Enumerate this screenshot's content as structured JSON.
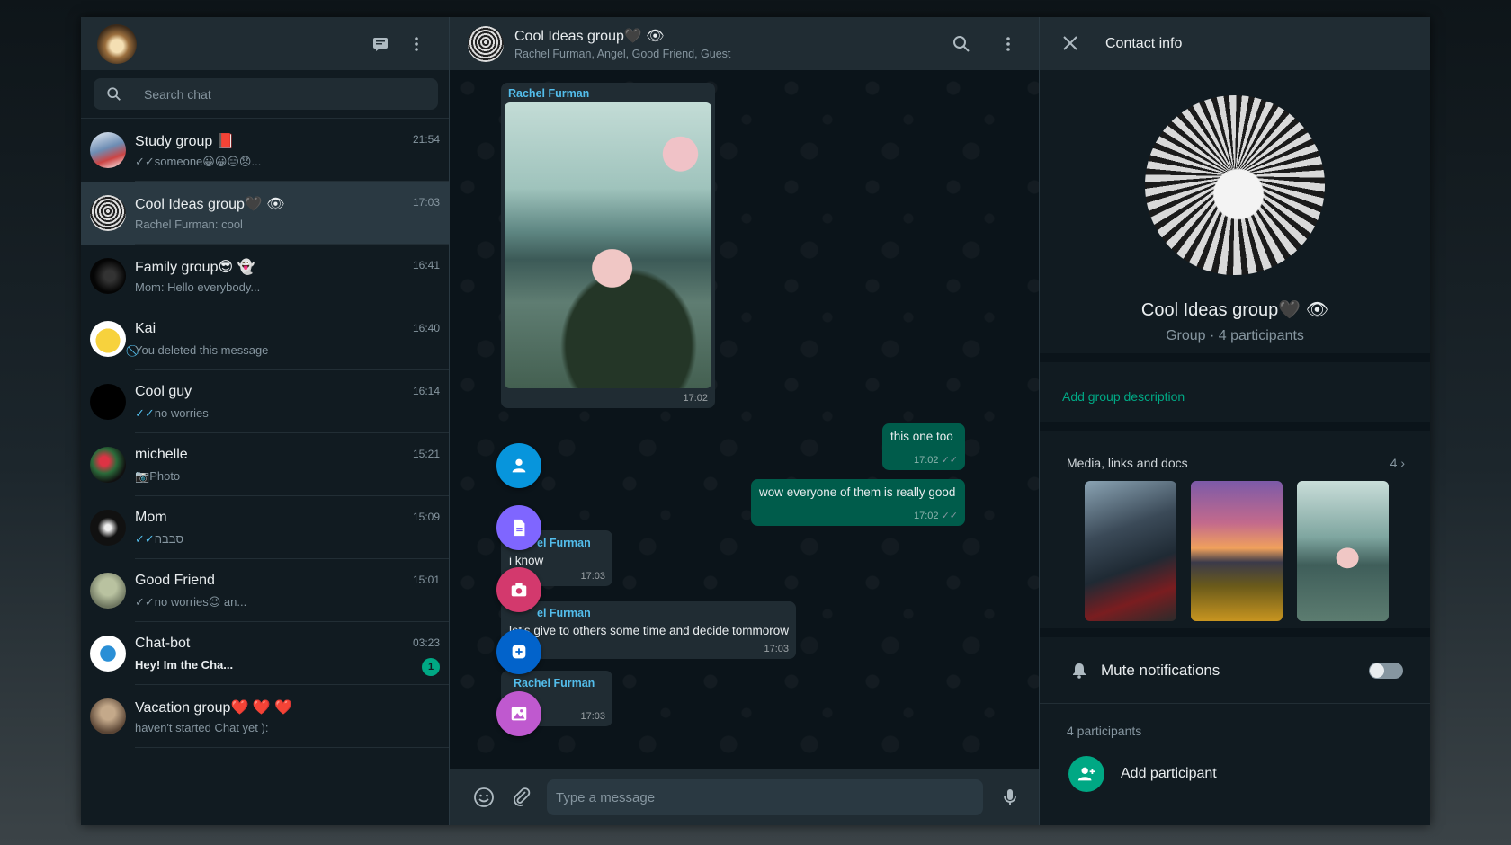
{
  "left": {
    "search_placeholder": "Search chat",
    "chats": [
      {
        "name": "Study group 📕",
        "time": "21:54",
        "tick": "✓✓",
        "preview": "someone😀😀😑😞...",
        "avatar": "linear-gradient(160deg,#e8eef5 0%,#6d8db4 45%,#c44 70%,#fff 100%)"
      },
      {
        "name": "Cool Ideas group🖤 👁",
        "time": "17:03",
        "tick": "",
        "preview": "Rachel Furman: cool",
        "avatar": "repeating-radial-gradient(circle at 50% 45%, #ddd 0 2px, #222 2px 4px)"
      },
      {
        "name": "Family group😎 👻",
        "time": "16:41",
        "tick": "",
        "preview": "Mom: Hello everybody...",
        "avatar": "radial-gradient(circle at 55% 50%, #333 0 20%, #050505 60%)"
      },
      {
        "name": "Kai",
        "time": "16:40",
        "tick": "⃠",
        "preview": "You deleted this message",
        "avatar": "radial-gradient(circle at 50% 55%, #f7d23d 0 45%, #fff 46%)"
      },
      {
        "name": "Cool guy",
        "time": "16:14",
        "tick": "✓✓",
        "preview": "no worries",
        "avatar": "#000"
      },
      {
        "name": "michelle",
        "time": "15:21",
        "tick": "📷",
        "preview": "Photo",
        "avatar": "radial-gradient(circle at 40% 40%, #d34 0 15%, #2b6b3a 40%, #111 70%)"
      },
      {
        "name": "Mom",
        "time": "15:09",
        "tick": "✓✓",
        "preview": "סבבה",
        "avatar": "radial-gradient(circle at 50% 50%, #eee 0 12%, #111 40%)"
      },
      {
        "name": "Good Friend",
        "time": "15:01",
        "tick": "✓✓",
        "preview": "no worries😉 an...",
        "avatar": "radial-gradient(circle at 50% 40%, #b9c2a0 0 30%, #6e7660 70%)"
      },
      {
        "name": "Chat-bot",
        "time": "03:23",
        "tick": "",
        "preview": "Hey! Im the Cha...",
        "bold": true,
        "unread": "1",
        "avatar": "radial-gradient(circle at 50% 50%, #2a8fd6 0 30%, #fff 32%)"
      },
      {
        "name": "Vacation group❤️ ❤️ ❤️",
        "time": "",
        "tick": "",
        "preview": "haven't started Chat yet ):",
        "avatar": "radial-gradient(circle at 50% 40%, #c4a98a 0 25%, #5a4535 70%)"
      }
    ]
  },
  "middle": {
    "title": "Cool Ideas group🖤 👁",
    "subtitle": "Rachel Furman, Angel, Good Friend, Guest",
    "compose_placeholder": "Type a message",
    "messages": {
      "photo_sender": "Rachel Furman",
      "photo_time": "17:02",
      "out1_text": "this one too",
      "out1_time": "17:02",
      "out2_text": "wow everyone of them is really good",
      "out2_time": "17:02",
      "in1_sender": "el Furman",
      "in1_text": "i know",
      "in1_time": "17:03",
      "in2_sender": "el Furman",
      "in2_text": "let's give to others some time and decide tommorow",
      "in2_time": "17:03",
      "in3_sender": "Rachel Furman",
      "in3_time": "17:03"
    }
  },
  "right": {
    "header_title": "Contact info",
    "group_name": "Cool Ideas group🖤 👁",
    "group_meta": "Group · 4 participants",
    "add_description": "Add group description",
    "media_label": "Media, links and docs",
    "media_count": "4",
    "mute_label": "Mute notifications",
    "participants_label": "4 participants",
    "add_participant": "Add participant"
  },
  "colors": {
    "accent": "#00a884",
    "outgoing": "#005c4b",
    "panel": "#202c33",
    "background": "#111b21"
  }
}
